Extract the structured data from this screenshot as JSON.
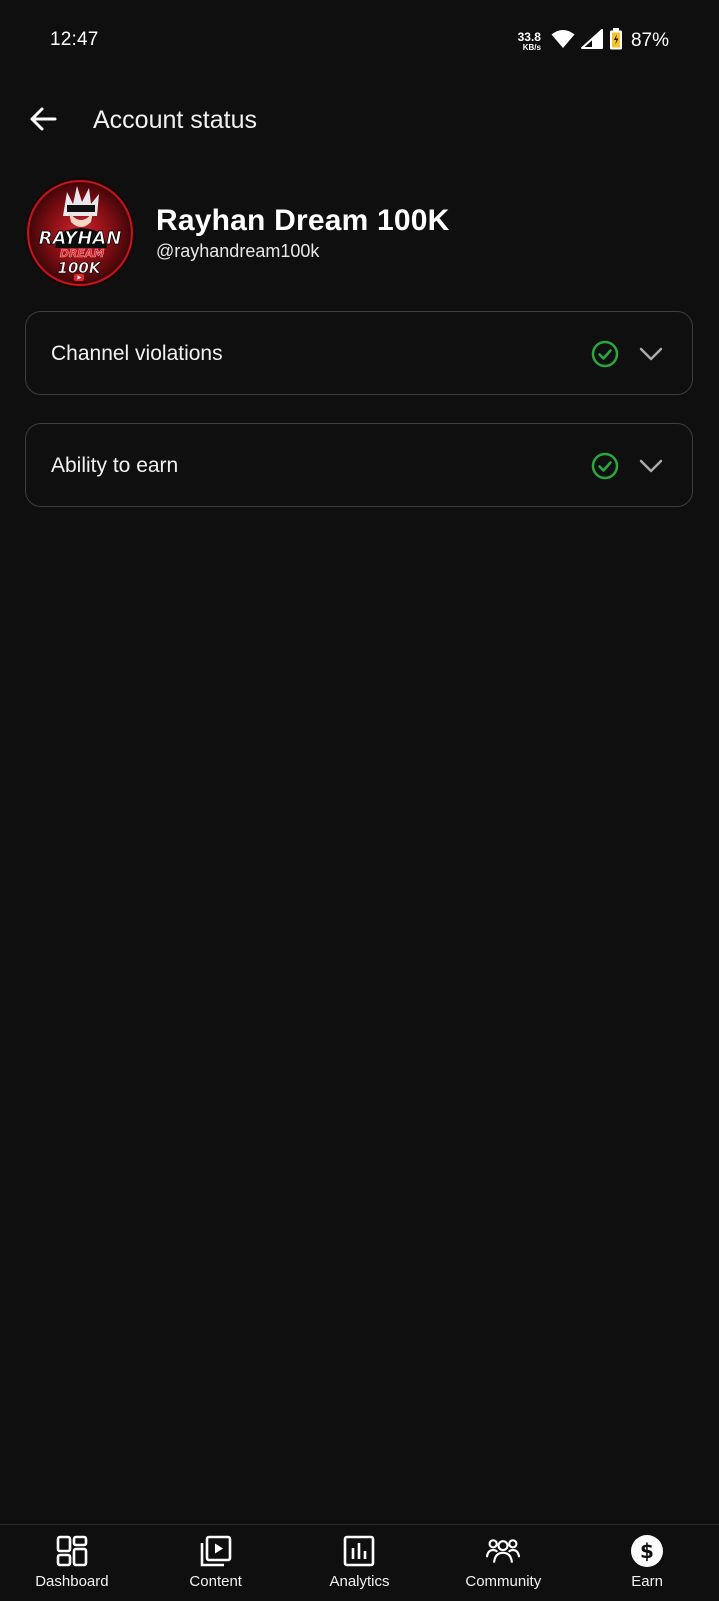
{
  "status_bar": {
    "time": "12:47",
    "net_speed_value": "33.8",
    "net_speed_unit": "KB/s",
    "battery": "87%",
    "icons": [
      "wifi-icon",
      "signal-icon",
      "battery-icon"
    ]
  },
  "header": {
    "title": "Account status",
    "back_icon": "arrow-left-icon"
  },
  "channel": {
    "name": "Rayhan Dream 100K",
    "handle": "@rayhandream100k",
    "avatar_text": [
      "RAYHAN",
      "DREAM",
      "100K"
    ]
  },
  "cards": [
    {
      "label": "Channel violations",
      "status_icon": "check-circle-icon",
      "status_color": "#2ba640"
    },
    {
      "label": "Ability to earn",
      "status_icon": "check-circle-icon",
      "status_color": "#2ba640"
    }
  ],
  "bottom_nav": [
    {
      "label": "Dashboard",
      "icon": "dashboard-icon"
    },
    {
      "label": "Content",
      "icon": "content-play-icon"
    },
    {
      "label": "Analytics",
      "icon": "analytics-icon"
    },
    {
      "label": "Community",
      "icon": "community-icon"
    },
    {
      "label": "Earn",
      "icon": "earn-dollar-icon"
    }
  ],
  "colors": {
    "background": "#0f0f0f",
    "text": "#f1f1f1",
    "card_border": "#3d3d3d",
    "success": "#2ba640",
    "avatar_accent": "#c4161c"
  }
}
